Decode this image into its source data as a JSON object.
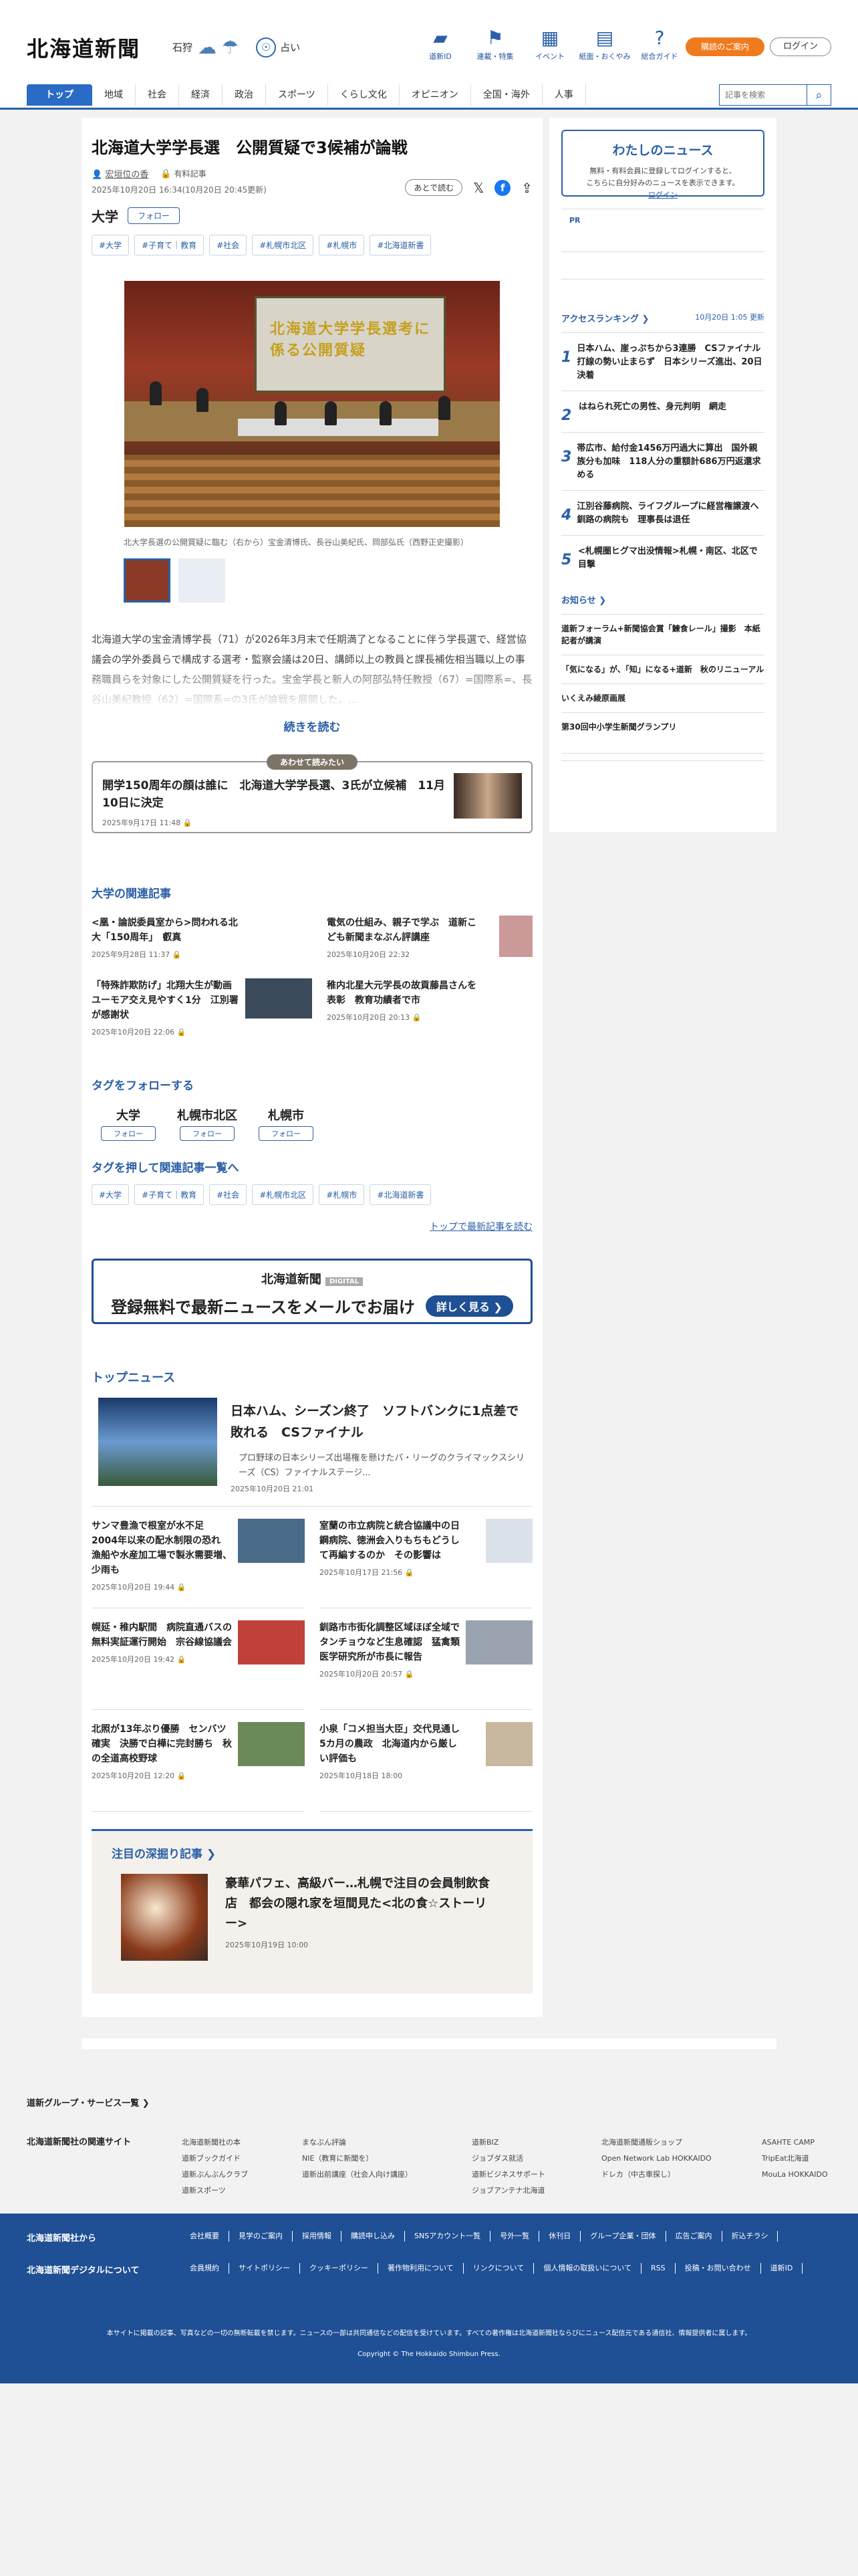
{
  "header": {
    "logo": "北海道新聞",
    "weather_city": "石狩",
    "fortune_label": "占い",
    "nav": [
      {
        "label": "道新ID",
        "icon": "id-card-icon",
        "glyph": "▰"
      },
      {
        "label": "連載・特集",
        "icon": "flag-icon",
        "glyph": "⚑"
      },
      {
        "label": "イベント",
        "icon": "calendar-icon",
        "glyph": "▦"
      },
      {
        "label": "紙面・おくやみ",
        "icon": "newspaper-icon",
        "glyph": "▤"
      },
      {
        "label": "総合ガイド",
        "icon": "help-icon",
        "glyph": "?"
      }
    ],
    "subscribe_label": "購読のご案内",
    "login_label": "ログイン"
  },
  "gnav": {
    "items": [
      "トップ",
      "地域",
      "社会",
      "経済",
      "政治",
      "スポーツ",
      "くらし文化",
      "オピニオン",
      "全国・海外",
      "人事"
    ],
    "search_placeholder": "記事を検索"
  },
  "article": {
    "title": "北海道大学学長選　公開質疑で3候補が論戦",
    "author": "宏垣位の香",
    "paid_label": "有料記事",
    "date": "2025年10月20日 16:34(10月20日 20:45更新)",
    "read_later": "あとで読む",
    "category": "大学",
    "follow_label": "フォロー",
    "tags": [
      "#大学",
      "#子育て｜教育",
      "#社会",
      "#札幌市北区",
      "#札幌市",
      "#北海道新書"
    ],
    "photo_screen_text": "北海道大学学長選考に係る公開質疑",
    "caption": "北大学長選の公開質疑に臨む（右から）宝金清博氏、長谷山美紀氏、岡部弘氏（西野正史撮影）",
    "lead": "北海道大学の宝金清博学長（71）が2026年3月末で任期満了となることに伴う学長選で、経営協議会の学外委員らで構成する選考・監察会議は20日、講師以上の教員と課長補佐相当職以上の事務職員らを対象にした公開質疑を行った。宝金学長と新人の阿部弘特任教授（67）=国際系=、長谷山美紀教授（62）=国際系=の3氏が論戦を展開した。...",
    "read_more": "続きを読む"
  },
  "together": {
    "label": "あわせて読みたい",
    "title": "開学150周年の顔は誰に　北海道大学学長選、3氏が立候補　11月10日に決定",
    "date": "2025年9月17日 11:48"
  },
  "related": {
    "heading": "大学の関連記事",
    "items": [
      {
        "title": "<凰・論説委員室から>問われる北大「150周年」　叡真",
        "date": "2025年9月28日 11:37"
      },
      {
        "title": "電気の仕組み、親子で学ぶ　道新こども新聞まなぶん評講座",
        "date": "2025年10月20日 22:32"
      },
      {
        "title": "「特殊詐欺防げ」北翔大生が動画　ユーモア交え見やすく1分　江別署が感謝状",
        "date": "2025年10月20日 22:06"
      },
      {
        "title": "稚内北星大元学長の故貢藤昌さんを表彰　教育功績者で市",
        "date": "2025年10月20日 20:13"
      }
    ]
  },
  "follow_tags": {
    "heading": "タグをフォローする",
    "items": [
      "大学",
      "札幌市北区",
      "札幌市"
    ],
    "button": "フォロー",
    "search_heading": "タグを押して関連記事一覧へ",
    "tags": [
      "#大学",
      "#子育て｜教育",
      "#社会",
      "#札幌市北区",
      "#札幌市",
      "#北海道新書"
    ],
    "top_link": "トップで最新記事を読む"
  },
  "banner": {
    "logo": "北海道新聞",
    "digital": "DIGITAL",
    "text": "登録無料で最新ニュースをメールでお届け",
    "button": "詳しく見る ❯"
  },
  "topnews": {
    "heading": "トップニュース",
    "main": {
      "title": "日本ハム、シーズン終了　ソフトバンクに1点差で敗れる　CSファイナル",
      "summary": "プロ野球の日本シリーズ出場権を懸けたパ・リーグのクライマックスシリーズ（CS）ファイナルステージ...",
      "date": "2025年10月20日 21:01"
    },
    "items": [
      {
        "title": "サンマ豊漁で根室が水不足　2004年以来の配水制限の恐れ　漁船や水産加工場で製氷需要増、少雨も",
        "date": "2025年10月20日 19:44"
      },
      {
        "title": "室蘭の市立病院と統合協議中の日鋼病院、徳洲会入りもちもどうして再編するのか　その影響は",
        "date": "2025年10月17日 21:56"
      },
      {
        "title": "幌延・稚内駅間　病院直通バスの無料実証運行開始　宗谷線協議会",
        "date": "2025年10月20日 19:42"
      },
      {
        "title": "釧路市市街化調整区域ほぼ全域でタンチョウなど生息確認　猛禽類医学研究所が市長に報告",
        "date": "2025年10月20日 20:57"
      },
      {
        "title": "北照が13年ぶり優勝　センバツ確実　決勝で白樺に完封勝ち　秋の全道高校野球",
        "date": "2025年10月20日 12:20"
      },
      {
        "title": "小泉「コメ担当大臣」交代見通し　5カ月の農政　北海道内から厳しい評価も",
        "date": "2025年10月18日 18:00"
      }
    ]
  },
  "deep": {
    "heading": "注目の深掘り記事 ❯",
    "title": "豪華パフェ、高級バー…札幌で注目の会員制飲食店　都会の隠れ家を垣間見た<北の食☆ストーリー>",
    "date": "2025年10月19日 10:00"
  },
  "sidebar": {
    "mynews_heading": "わたしのニュース",
    "mynews_text_1": "無料・有料会員に登録してログインすると、",
    "mynews_link": "ログイン",
    "mynews_text_2": "こちらに自分好みのニュースを表示できます。",
    "pr": "PR",
    "ranking_heading": "アクセスランキング ❯",
    "ranking_updated": "10月20日 1:05 更新",
    "ranking": [
      "日本ハム、崖っぷちから3連勝　CSファイナル　打線の勢い止まらず　日本シリーズ進出、20日決着",
      "はねられ死亡の男性、身元判明　網走",
      "帯広市、給付金1456万円過大に算出　国外親族分も加味　118人分の重額計686万円返還求める",
      "江別谷藤病院、ライフグループに経営権譲渡へ　釧路の病院も　理事長は退任",
      "<札幌圏ヒグマ出没情報>札幌・南区、北区で目撃"
    ],
    "notice_heading": "お知らせ ❯",
    "notices": [
      "道新フォーラム+新聞協会賞「鰊食レール」撮影　本紙記者が講演",
      "「気になる」が、「知」になる+道新　秋のリニューアル",
      "いくえみ綾原画展",
      "第30回中小学生新聞グランプリ"
    ]
  },
  "footer": {
    "services_heading": "道新グループ・サービス一覧 ❯",
    "related_heading": "北海道新聞社の関連サイト",
    "cols": [
      [
        "北海道新聞社の本",
        "道新ブックガイド",
        "道新ぶんぶんクラブ",
        "道新スポーツ"
      ],
      [
        "まなぶん評論",
        "NIE（教育に新聞を）",
        "道新出前講座（社会人向け講座）"
      ],
      [
        "道新BIZ",
        "ジョブダス就活",
        "道新ビジネスサポート",
        "ジョブアンテナ北海道"
      ],
      [
        "北海道新聞通販ショップ",
        "Open Network Lab HOKKAIDO",
        "ドレカ（中古車探し）"
      ],
      [
        "ASAHTE CAMP",
        "TripEat北海道",
        "MouLa HOKKAIDO"
      ]
    ],
    "dark_label_1": "北海道新聞社から",
    "dark_label_2": "北海道新聞デジタルについて",
    "links_1": [
      "会社概要",
      "見学のご案内",
      "採用情報",
      "購読申し込み",
      "SNSアカウント一覧",
      "号外一覧",
      "休刊日",
      "グループ企業・団体",
      "広告ご案内",
      "折込チラシ"
    ],
    "links_2": [
      "会員規約",
      "サイトポリシー",
      "クッキーポリシー",
      "著作物利用について",
      "リンクについて",
      "個人情報の取扱いについて",
      "RSS",
      "投稿・お問い合わせ",
      "道新ID"
    ],
    "note": "本サイトに掲載の記事、写真などの一切の無断転載を禁じます。ニュースの一部は共同通信などの配信を受けています。すべての著作権は北海道新聞社ならびにニュース配信元である通信社、情報提供者に属します。",
    "copyright": "Copyright © The Hokkaido Shimbun Press."
  }
}
